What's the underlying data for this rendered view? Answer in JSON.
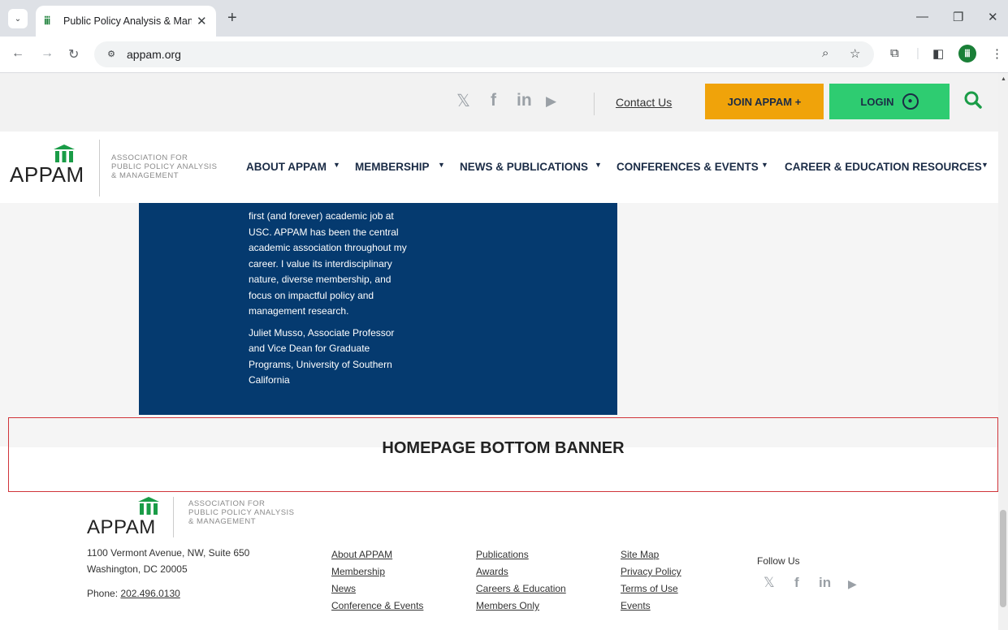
{
  "browser": {
    "tab_title": "Public Policy Analysis & Manage",
    "tab_close": "✕",
    "new_tab": "+",
    "url": "appam.org",
    "menu_glyph": "⌄",
    "win_min": "—",
    "win_restore": "❐",
    "win_close": "✕"
  },
  "header": {
    "contact": "Contact Us",
    "join": "JOIN APPAM +",
    "login": "LOGIN"
  },
  "logo": {
    "name": "APPAM",
    "sub_line1": "ASSOCIATION FOR",
    "sub_line2": "PUBLIC POLICY ANALYSIS",
    "sub_line3": "& MANAGEMENT"
  },
  "nav": {
    "items": [
      {
        "label": "ABOUT APPAM"
      },
      {
        "label": "MEMBERSHIP"
      },
      {
        "label": "NEWS & PUBLICATIONS"
      },
      {
        "label": "CONFERENCES & EVENTS"
      },
      {
        "label": "CAREER & EDUCATION RESOURCES"
      }
    ]
  },
  "quote": {
    "body": "first (and forever) academic job at USC. APPAM has been the central academic association throughout my career. I value its interdisciplinary nature, diverse membership, and focus on impactful policy and management research.",
    "attribution": "Juliet Musso, Associate Professor and Vice Dean for Graduate Programs, University of Southern California"
  },
  "banner": {
    "label": "HOMEPAGE BOTTOM BANNER"
  },
  "footer": {
    "address1": "1100 Vermont Avenue, NW, Suite 650",
    "address2": "Washington, DC 20005",
    "phone_label": "Phone:",
    "phone": "202.496.0130",
    "col1": [
      "About APPAM",
      "Membership",
      "News",
      "Conference & Events"
    ],
    "col2": [
      "Publications",
      "Awards",
      "Careers & Education",
      "Members Only"
    ],
    "col3": [
      "Site Map",
      "Privacy Policy",
      "Terms of Use",
      "Events"
    ],
    "follow": "Follow Us"
  },
  "icons": {
    "x": "𝕏",
    "facebook": "f",
    "linkedin": "in",
    "youtube": "▶"
  }
}
